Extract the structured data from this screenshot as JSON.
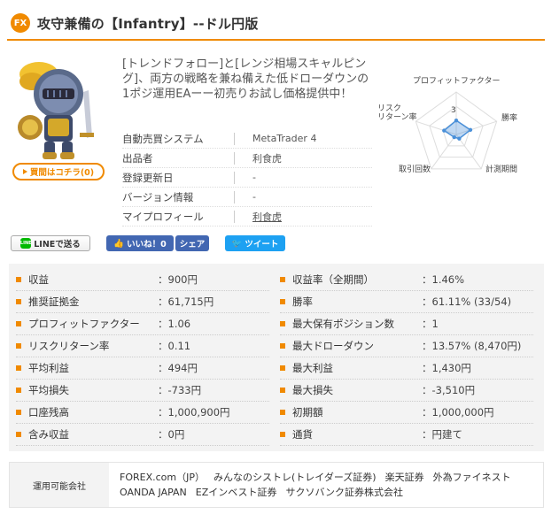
{
  "header": {
    "badge": "FX",
    "title": "攻守兼備の【Infantry】--ドル円版"
  },
  "product": {
    "buy_button_label": "買間はコチラ(0)",
    "description": "[トレンドフォロー]と[レンジ相場スキャルピング]、両方の戦略を兼ね備えた低ドローダウンの1ポジ運用EAーー初売りお試し価格提供中！",
    "info": [
      {
        "label": "自動売買システム",
        "value": "MetaTrader 4",
        "link": false
      },
      {
        "label": "出品者",
        "value": "利食虎",
        "link": false
      },
      {
        "label": "登録更新日",
        "value": "-",
        "link": false
      },
      {
        "label": "バージョン情報",
        "value": "-",
        "link": false
      },
      {
        "label": "マイプロフィール",
        "value": "利食虎",
        "link": true
      }
    ]
  },
  "radar": {
    "labels": [
      "プロフィットファクター",
      "勝率",
      "計測期間",
      "取引回数",
      "リスク\nリターン率"
    ],
    "scale_label": "3",
    "values": [
      0.33,
      0.35,
      0.12,
      0.08,
      0.3
    ],
    "grid_color": "#dddddd",
    "data_color": "#4a90d9"
  },
  "social": {
    "line_label": "LINEで送る",
    "line_icon_text": "LINE",
    "fb_label": "いいね！0",
    "share_label": "シェア",
    "tweet_label": "ツイート"
  },
  "stats": {
    "left": [
      {
        "label": "収益",
        "value": "：900円"
      },
      {
        "label": "推奨証拠金",
        "value": "：61,715円"
      },
      {
        "label": "プロフィットファクター",
        "value": "：1.06"
      },
      {
        "label": "リスクリターン率",
        "value": "：0.11"
      },
      {
        "label": "平均利益",
        "value": "：494円"
      },
      {
        "label": "平均損失",
        "value": "：-733円"
      },
      {
        "label": "口座残高",
        "value": "：1,000,900円"
      },
      {
        "label": "含み収益",
        "value": "：0円"
      }
    ],
    "right": [
      {
        "label": "収益率（全期間）",
        "value": "：1.46%"
      },
      {
        "label": "勝率",
        "value": "：61.11% (33/54)"
      },
      {
        "label": "最大保有ポジション数",
        "value": "：1"
      },
      {
        "label": "最大ドローダウン",
        "value": "：13.57% (8,470円)"
      },
      {
        "label": "最大利益",
        "value": "：1,430円"
      },
      {
        "label": "最大損失",
        "value": "：-3,510円"
      },
      {
        "label": "初期額",
        "value": "：1,000,000円"
      },
      {
        "label": "通貨",
        "value": "：円建て"
      }
    ]
  },
  "brokers": {
    "label": "運用可能会社",
    "items": [
      "FOREX.com（JP）",
      "みんなのシストレ(トレイダーズ証券)",
      "楽天証券",
      "外為ファイネスト",
      "OANDA JAPAN",
      "EZインベスト証券",
      "サクソバンク証券株式会社"
    ]
  },
  "colors": {
    "accent": "#f08a00",
    "facebook": "#4267b2",
    "twitter": "#1da1f2",
    "line": "#00b900"
  }
}
